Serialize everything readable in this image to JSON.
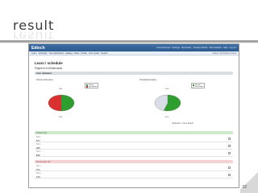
{
  "slide": {
    "title": "result",
    "page_number": "32"
  },
  "app": {
    "logo": "Edtech",
    "top_links": [
      "Find resources",
      "Settings",
      "Homestars",
      "Timeline Mobile",
      "About Edtech",
      "Help",
      "Log out"
    ],
    "nav_items": [
      "Learn",
      "Schedule",
      "Your dashboard",
      "Catalog",
      "Notes",
      "Profile",
      "Your review",
      "Search"
    ],
    "nav_right": "Status: Scheduled, Active"
  },
  "page": {
    "title": "Learn / schedule",
    "subtitle": "Played 6 of 8 flashcards",
    "stats_header": "Your statistics"
  },
  "charts": {
    "left_title": "Scores this Hour",
    "right_title": "Overall Accuracy",
    "publication": "publication: | View Report",
    "left_legend": [
      "Known",
      "Not known"
    ],
    "right_legend": [
      "Known",
      "Not known"
    ]
  },
  "chart_data": [
    {
      "type": "pie",
      "title": "Scores this Hour",
      "labels": [
        "Known",
        "Not known"
      ],
      "values": [
        50,
        50
      ],
      "colors": [
        "#2e9e2e",
        "#d93030"
      ]
    },
    {
      "type": "pie",
      "title": "Overall Accuracy",
      "labels": [
        "Known",
        "Not known"
      ],
      "values": [
        55,
        45
      ],
      "colors": [
        "#2e9e2e",
        "#d8dde6"
      ]
    }
  ],
  "sections": {
    "known_header": "Known (4)",
    "known_items": [
      {
        "label": "Term",
        "value": "577"
      },
      {
        "label": "Term",
        "value": "936"
      },
      {
        "label": "Term",
        "value": "$18"
      }
    ],
    "not_known_header": "Not known (2)",
    "not_known_items": [
      {
        "label": "Term",
        "value": "271"
      },
      {
        "label": "Term",
        "value": "133"
      }
    ]
  }
}
